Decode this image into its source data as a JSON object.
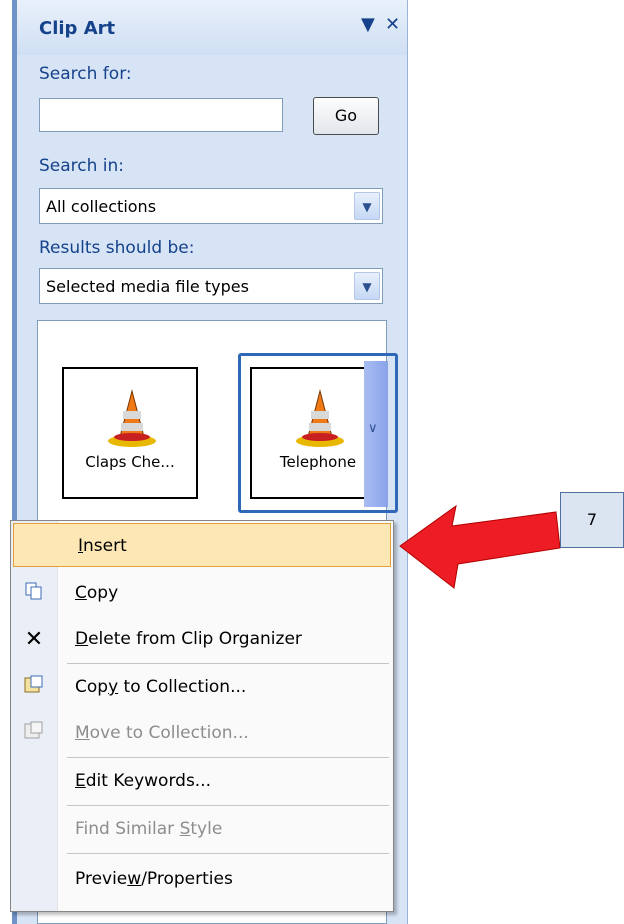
{
  "pane": {
    "title": "Clip Art",
    "dropdown_glyph": "▼",
    "close_glyph": "✕",
    "search_for_label": "Search for:",
    "search_value": "",
    "go_label": "Go",
    "search_in_label": "Search in:",
    "search_in_value": "All collections",
    "results_label": "Results should be:",
    "results_value": "Selected media file types"
  },
  "results": {
    "items": [
      {
        "caption": "Claps Che..."
      },
      {
        "caption": "Telephone"
      }
    ]
  },
  "context_menu": {
    "items": [
      {
        "label": "Insert",
        "underline": "I",
        "rest": "nsert"
      },
      {
        "label": "Copy",
        "underline": "C",
        "rest": "opy"
      },
      {
        "label": "Delete from Clip Organizer",
        "underline": "D",
        "rest": "elete from Clip Organizer"
      },
      {
        "label": "Copy to Collection...",
        "pre": "Cop",
        "underline": "y",
        "rest": " to Collection..."
      },
      {
        "label": "Move to Collection...",
        "underline": "M",
        "rest": "ove to Collection..."
      },
      {
        "label": "Edit Keywords...",
        "underline": "E",
        "rest": "dit Keywords..."
      },
      {
        "label": "Find Similar Style",
        "pre": "Find Similar ",
        "underline": "S",
        "rest": "tyle"
      },
      {
        "label": "Preview/Properties",
        "pre": "Previe",
        "underline": "w",
        "rest": "/Properties"
      }
    ]
  },
  "callout": {
    "number": "7"
  },
  "colors": {
    "arrow": "#ee1c24",
    "highlight": "#fde7b5",
    "title": "#15428b"
  }
}
